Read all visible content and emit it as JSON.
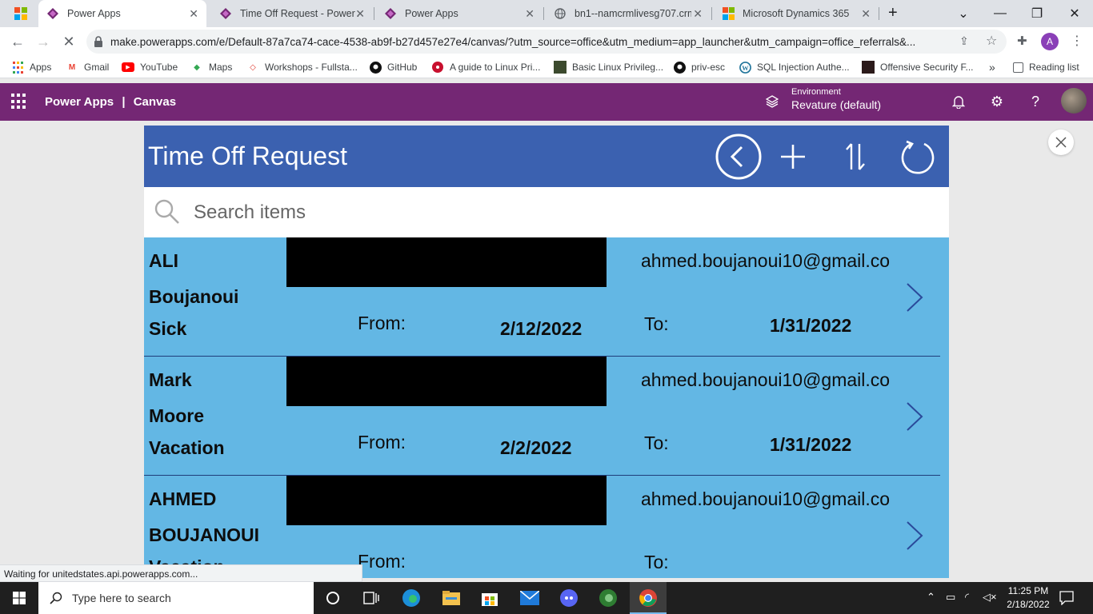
{
  "browser": {
    "tabs": [
      {
        "title": "Power Apps",
        "active": true
      },
      {
        "title": "Time Off Request - Power A",
        "active": false
      },
      {
        "title": "Power Apps",
        "active": false
      },
      {
        "title": "bn1--namcrmlivesg707.crm",
        "active": false
      },
      {
        "title": "Microsoft Dynamics 365",
        "active": false
      }
    ],
    "new_tab": "+",
    "url": "make.powerapps.com/e/Default-87a7ca74-cace-4538-ab9f-b27d457e27e4/canvas/?utm_source=office&utm_medium=app_launcher&utm_campaign=office_referrals&...",
    "profile_initial": "A",
    "bookmarks": [
      {
        "label": "Apps",
        "icon": "apps-grid-icon"
      },
      {
        "label": "Gmail",
        "icon": "gmail-icon"
      },
      {
        "label": "YouTube",
        "icon": "youtube-icon"
      },
      {
        "label": "Maps",
        "icon": "maps-icon"
      },
      {
        "label": "Workshops - Fullsta...",
        "icon": "workshops-icon"
      },
      {
        "label": "GitHub",
        "icon": "github-icon"
      },
      {
        "label": "A guide to Linux Pri...",
        "icon": "guide-icon"
      },
      {
        "label": "Basic Linux Privileg...",
        "icon": "linux-icon"
      },
      {
        "label": "priv-esc",
        "icon": "github-icon"
      },
      {
        "label": "SQL Injection Authe...",
        "icon": "wordpress-icon"
      },
      {
        "label": "Offensive Security F...",
        "icon": "offsec-icon"
      }
    ],
    "more_bookmarks": "»",
    "reading_list": "Reading list",
    "status": "Waiting for unitedstates.api.powerapps.com..."
  },
  "powerapps": {
    "brand": "Power Apps",
    "separator": "|",
    "mode": "Canvas",
    "environment_label": "Environment",
    "environment_value": "Revature (default)"
  },
  "app": {
    "title": "Time Off Request",
    "search_placeholder": "Search items",
    "labels": {
      "from": "From:",
      "to": "To:"
    },
    "records": [
      {
        "first": "ALI",
        "last": "Boujanoui",
        "type": "Sick",
        "email": "ahmed.boujanoui10@gmail.co",
        "from": "2/12/2022",
        "to": "1/31/2022"
      },
      {
        "first": "Mark",
        "last": "Moore",
        "type": "Vacation",
        "email": "ahmed.boujanoui10@gmail.co",
        "from": "2/2/2022",
        "to": "1/31/2022"
      },
      {
        "first": "AHMED",
        "last": "BOUJANOUI",
        "type": "Vacation",
        "email": "ahmed.boujanoui10@gmail.co",
        "from": "",
        "to": ""
      }
    ],
    "colors": {
      "header": "#3b61b0",
      "gallery": "#63b7e4",
      "separator": "#1f3d7a"
    }
  },
  "taskbar": {
    "search_placeholder": "Type here to search",
    "time": "11:25 PM",
    "date": "2/18/2022"
  }
}
